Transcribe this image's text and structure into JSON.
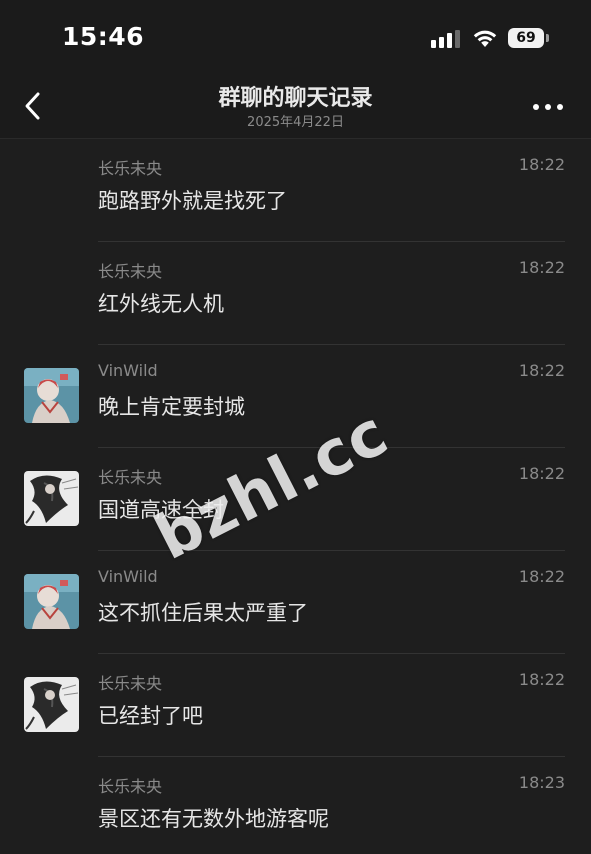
{
  "status_bar": {
    "time": "15:46",
    "battery": "69",
    "icons": [
      "cellular-signal-icon",
      "wifi-icon",
      "battery-icon"
    ]
  },
  "header": {
    "title": "群聊的聊天记录",
    "subtitle": "2025年4月22日",
    "back_icon": "chevron-left-icon",
    "more_icon": "more-dots-icon"
  },
  "messages": [
    {
      "sender": "长乐未央",
      "time": "18:22",
      "text": "跑路野外就是找死了",
      "avatar": ""
    },
    {
      "sender": "长乐未央",
      "time": "18:22",
      "text": "红外线无人机",
      "avatar": ""
    },
    {
      "sender": "VinWild",
      "time": "18:22",
      "text": "晚上肯定要封城",
      "avatar": "vinwild"
    },
    {
      "sender": "长乐未央",
      "time": "18:22",
      "text": "国道高速全封",
      "avatar": "changle"
    },
    {
      "sender": "VinWild",
      "time": "18:22",
      "text": "这不抓住后果太严重了",
      "avatar": "vinwild"
    },
    {
      "sender": "长乐未央",
      "time": "18:22",
      "text": "已经封了吧",
      "avatar": "changle"
    },
    {
      "sender": "长乐未央",
      "time": "18:23",
      "text": "景区还有无数外地游客呢",
      "avatar": ""
    }
  ],
  "watermark": "bzhl.cc",
  "colors": {
    "background": "#1e1e1e",
    "text_primary": "#e6e6e6",
    "text_secondary": "#8a8a8a",
    "divider": "#333333"
  }
}
